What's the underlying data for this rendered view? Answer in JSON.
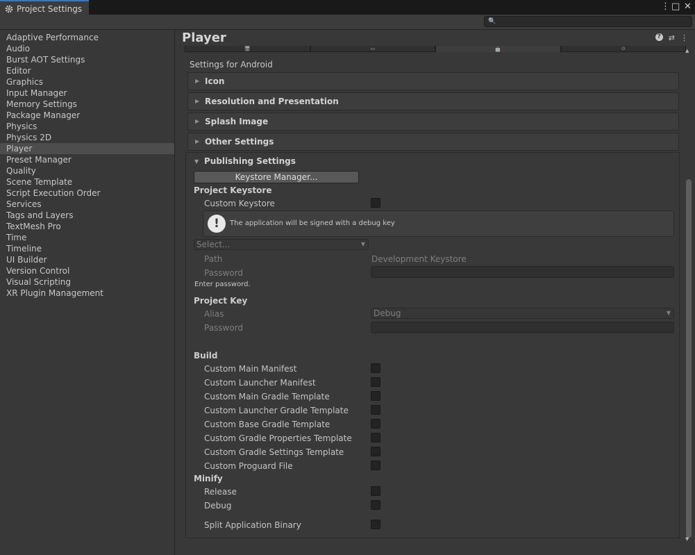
{
  "window": {
    "tab_title": "Project Settings",
    "tab_icon": "gear-icon",
    "controls": [
      "⋮",
      "□",
      "✕"
    ]
  },
  "search": {
    "icon": "🔍",
    "placeholder": ""
  },
  "sidebar": {
    "selected": "Player",
    "items": [
      "Adaptive Performance",
      "Audio",
      "Burst AOT Settings",
      "Editor",
      "Graphics",
      "Input Manager",
      "Memory Settings",
      "Package Manager",
      "Physics",
      "Physics 2D",
      "Player",
      "Preset Manager",
      "Quality",
      "Scene Template",
      "Script Execution Order",
      "Services",
      "Tags and Layers",
      "TextMesh Pro",
      "Time",
      "Timeline",
      "UI Builder",
      "Version Control",
      "Visual Scripting",
      "XR Plugin Management"
    ]
  },
  "header": {
    "title": "Player",
    "icons": {
      "help": "?",
      "presets": "⇄",
      "menu": "⋮"
    }
  },
  "platform_tabs": [
    "🖥",
    "▭",
    "🤖",
    "⊙"
  ],
  "settings_for": "Settings for Android",
  "foldouts": [
    "Icon",
    "Resolution and Presentation",
    "Splash Image",
    "Other Settings"
  ],
  "publishing": {
    "title": "Publishing Settings",
    "keystore_button": "Keystore Manager...",
    "project_keystore": {
      "heading": "Project Keystore",
      "custom_keystore_label": "Custom Keystore",
      "custom_keystore_checked": false,
      "help_message": "The application will be signed with a debug key",
      "select_value": "Select...",
      "path_label": "Path",
      "path_value": "Development Keystore",
      "password_label": "Password",
      "password_value": "",
      "password_hint": "Enter password."
    },
    "project_key": {
      "heading": "Project Key",
      "alias_label": "Alias",
      "alias_value": "Debug",
      "password_label": "Password",
      "password_value": ""
    },
    "build": {
      "heading": "Build",
      "items": [
        {
          "label": "Custom Main Manifest",
          "checked": false
        },
        {
          "label": "Custom Launcher Manifest",
          "checked": false
        },
        {
          "label": "Custom Main Gradle Template",
          "checked": false
        },
        {
          "label": "Custom Launcher Gradle Template",
          "checked": false
        },
        {
          "label": "Custom Base Gradle Template",
          "checked": false
        },
        {
          "label": "Custom Gradle Properties Template",
          "checked": false
        },
        {
          "label": "Custom Gradle Settings Template",
          "checked": false
        },
        {
          "label": "Custom Proguard File",
          "checked": false
        }
      ]
    },
    "minify": {
      "heading": "Minify",
      "items": [
        {
          "label": "Release",
          "checked": false
        },
        {
          "label": "Debug",
          "checked": false
        }
      ]
    },
    "split_binary": {
      "label": "Split Application Binary",
      "checked": false
    }
  }
}
